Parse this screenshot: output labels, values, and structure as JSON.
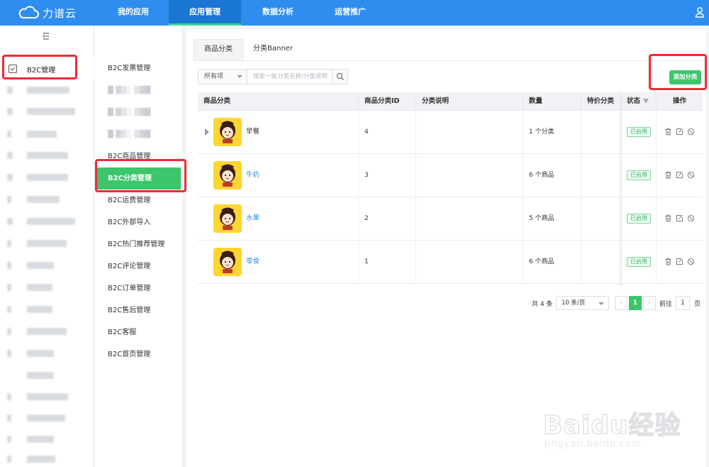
{
  "app": {
    "brand": "力谱云"
  },
  "nav": {
    "items": [
      {
        "label": "我的应用"
      },
      {
        "label": "应用管理"
      },
      {
        "label": "数据分析"
      },
      {
        "label": "运营推广"
      }
    ],
    "active": "应用管理"
  },
  "rail": {
    "b2c_label": "B2C管理"
  },
  "submenu": {
    "items": [
      {
        "label": "B2C发票管理"
      },
      {
        "label": "B2C商品管理"
      },
      {
        "label": "B2C分类管理"
      },
      {
        "label": "B2C运费管理"
      },
      {
        "label": "B2C外部导入"
      },
      {
        "label": "B2C热门推荐管理"
      },
      {
        "label": "B2C评论管理"
      },
      {
        "label": "B2C订单管理"
      },
      {
        "label": "B2C售后管理"
      },
      {
        "label": "B2C客服"
      },
      {
        "label": "B2C首页管理"
      }
    ],
    "active": "B2C分类管理"
  },
  "tabs": [
    {
      "label": "商品分类"
    },
    {
      "label": "分类Banner"
    }
  ],
  "filter": {
    "select_value": "所有项",
    "search_placeholder": "搜索一级分类名称/分类说明"
  },
  "add_button": "添加分类",
  "table": {
    "headers": [
      "商品分类",
      "商品分类ID",
      "分类说明",
      "数量",
      "特价分类",
      "状态",
      "操作"
    ],
    "rows": [
      {
        "name": "早餐",
        "id": "4",
        "desc": "",
        "count": "1 个分类",
        "status": "已启用",
        "expandable": true
      },
      {
        "name": "牛奶",
        "id": "3",
        "desc": "",
        "count": "6 个商品",
        "status": "已启用",
        "expandable": false
      },
      {
        "name": "水果",
        "id": "2",
        "desc": "",
        "count": "5 个商品",
        "status": "已启用",
        "expandable": false
      },
      {
        "name": "零食",
        "id": "1",
        "desc": "",
        "count": "6 个商品",
        "status": "已启用",
        "expandable": false
      }
    ]
  },
  "pagination": {
    "total": "共 4 条",
    "page_size": "10 条/页",
    "prev": "‹",
    "current": "1",
    "next": "›",
    "goto_label": "前往",
    "goto_value": "1",
    "page_unit": "页"
  },
  "watermark": {
    "main": "Baidu经验",
    "sub": "jingyan.baidu.com"
  },
  "colors": {
    "topbar": "#2f8df0",
    "accent_green": "#3cc56b",
    "highlight_red": "#ef2b36",
    "link_blue": "#2f8df0"
  }
}
